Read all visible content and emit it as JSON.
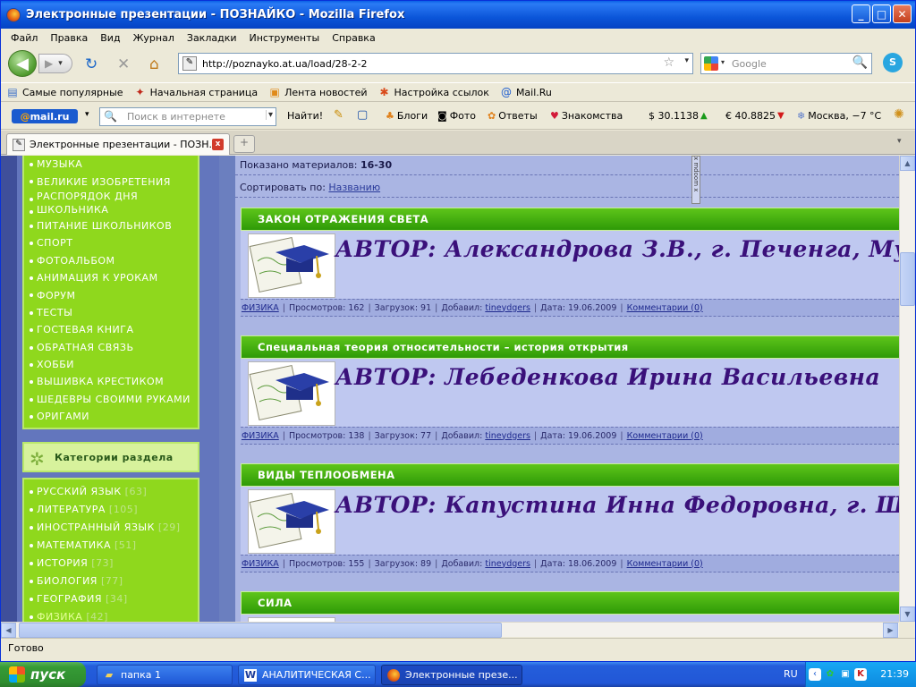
{
  "window": {
    "title": "Электронные презентации - ПОЗНАЙКО - Mozilla Firefox",
    "btn_min": "_",
    "btn_max": "□",
    "btn_close": "✕"
  },
  "menubar": [
    "Файл",
    "Правка",
    "Вид",
    "Журнал",
    "Закладки",
    "Инструменты",
    "Справка"
  ],
  "nav": {
    "back": "◀",
    "forward": "▶",
    "forward_dd": "▾",
    "reload": "↻",
    "stop": "✕",
    "home": "⌂",
    "url": "http://poznayko.at.ua/load/28-2-2",
    "star": "☆",
    "url_dd": "▾",
    "search_placeholder": "Google",
    "search_dd": "▾",
    "search_mag": "🔍",
    "skype": "S"
  },
  "bookmarks": [
    "Самые популярные",
    "Начальная страница",
    "Лента новостей",
    "Настройка ссылок",
    "Mail.Ru"
  ],
  "mailbar": {
    "logo_at": "@",
    "logo_rest": "mail.ru",
    "logo_dd": "▾",
    "search_placeholder": "Поиск в интернете",
    "search_dd": "▾",
    "find": "Найти!",
    "blogs": "Блоги",
    "photo": "Фото",
    "answers": "Ответы",
    "dating": "Знакомства",
    "usd": "$ 30.1138",
    "usd_trend": "▲",
    "eur": "€ 40.8825",
    "eur_trend": "▼",
    "weather": "Москва, −7 °С"
  },
  "tab": {
    "label": "Электронные презентации - ПОЗН...",
    "close": "x",
    "new_tab": "+",
    "scroll": "▾"
  },
  "left_menu": [
    "МУЗЫКА",
    "ВЕЛИКИЕ ИЗОБРЕТЕНИЯ",
    "РАСПОРЯДОК ДНЯ",
    "ШКОЛЬНИКА",
    "ПИТАНИЕ ШКОЛЬНИКОВ",
    "СПОРТ",
    "ФОТОАЛЬБОМ",
    "АНИМАЦИЯ К УРОКАМ",
    "ФОРУМ",
    "ТЕСТЫ",
    "ГОСТЕВАЯ КНИГА",
    "ОБРАТНАЯ СВЯЗЬ",
    "ХОББИ",
    "ВЫШИВКА КРЕСТИКОМ",
    "ШЕДЕВРЫ СВОИМИ РУКАМИ",
    "ОРИГАМИ"
  ],
  "categories": {
    "header": "Категории раздела",
    "items": [
      {
        "label": "РУССКИЙ ЯЗЫК",
        "count": "[63]"
      },
      {
        "label": "ЛИТЕРАТУРА",
        "count": "[105]"
      },
      {
        "label": "ИНОСТРАННЫЙ ЯЗЫК",
        "count": "[29]"
      },
      {
        "label": "МАТЕМАТИКА",
        "count": "[51]"
      },
      {
        "label": "ИСТОРИЯ",
        "count": "[73]"
      },
      {
        "label": "БИОЛОГИЯ",
        "count": "[77]"
      },
      {
        "label": "ГЕОГРАФИЯ",
        "count": "[34]"
      },
      {
        "label": "ФИЗИКА",
        "count": "[42]"
      }
    ]
  },
  "listing": {
    "shown_label": "Показано материалов:",
    "shown_value": "16-30",
    "sort_label": "Сортировать по:",
    "sort_value": "Названию",
    "ad_stub": "x mdoom x"
  },
  "entries": [
    {
      "title": "ЗАКОН ОТРАЖЕНИЯ СВЕТА",
      "author": "АВТОР: Александрова З.В., г. Печенга, Мурманской",
      "category": "ФИЗИКА",
      "views": "Просмотров: 162",
      "downloads": "Загрузок: 91",
      "added_by_label": "Добавил:",
      "added_by": "tineydgers",
      "date": "Дата: 19.06.2009",
      "comments": "Комментарии (0)"
    },
    {
      "title": "Специальная теория относительности – история открытия",
      "author": "АВТОР: Лебеденкова Ирина Васильевна",
      "category": "ФИЗИКА",
      "views": "Просмотров: 138",
      "downloads": "Загрузок: 77",
      "added_by_label": "Добавил:",
      "added_by": "tineydgers",
      "date": "Дата: 19.06.2009",
      "comments": "Комментарии (0)"
    },
    {
      "title": "ВИДЫ ТЕПЛООБМЕНА",
      "author": "АВТОР: Капустина Инна Федоровна, г. Шуя",
      "category": "ФИЗИКА",
      "views": "Просмотров: 155",
      "downloads": "Загрузок: 89",
      "added_by_label": "Добавил:",
      "added_by": "tineydgers",
      "date": "Дата: 18.06.2009",
      "comments": "Комментарии (0)"
    },
    {
      "title": "СИЛА"
    }
  ],
  "scroll": {
    "up": "▲",
    "down": "▼",
    "left": "◀",
    "right": "▶"
  },
  "status": "Готово",
  "taskbar": {
    "start": "пуск",
    "tasks": [
      "папка 1",
      "АНАЛИТИЧЕСКАЯ С...",
      "Электронные презе..."
    ],
    "lang": "RU",
    "clock": "21:39"
  }
}
